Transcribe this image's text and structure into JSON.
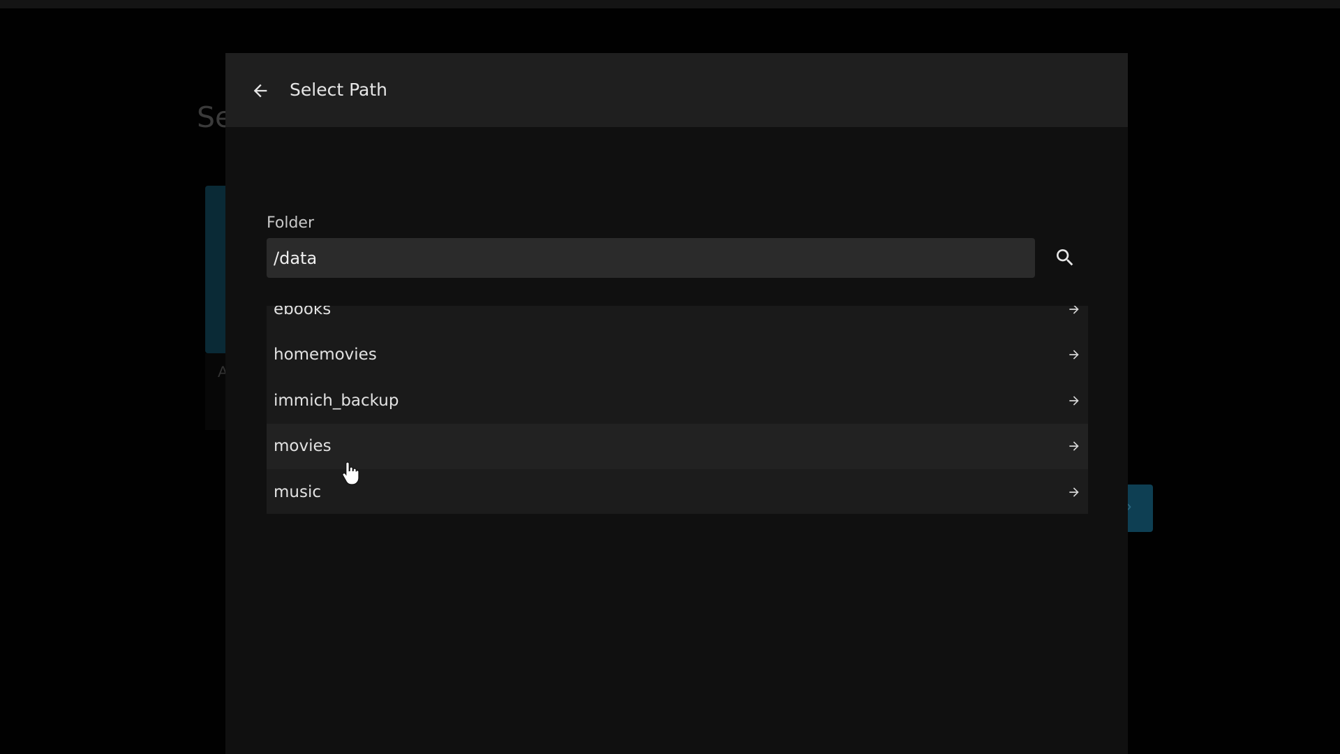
{
  "background": {
    "title_fragment": "Se",
    "card_letter": "A"
  },
  "dialog": {
    "title": "Select Path",
    "back_icon": "arrow-left-icon",
    "folder_label": "Folder",
    "folder_value": "/data",
    "search_icon": "search-icon",
    "items": [
      {
        "label": "ebooks",
        "icon": "arrow-right-icon"
      },
      {
        "label": "homemovies",
        "icon": "arrow-right-icon"
      },
      {
        "label": "immich_backup",
        "icon": "arrow-right-icon"
      },
      {
        "label": "movies",
        "icon": "arrow-right-icon"
      },
      {
        "label": "music",
        "icon": "arrow-right-icon"
      }
    ]
  },
  "colors": {
    "dialog_bg": "#101010",
    "header_bg": "#1f1f1f",
    "input_bg": "#2b2b2b",
    "accent": "#0e3f53"
  }
}
